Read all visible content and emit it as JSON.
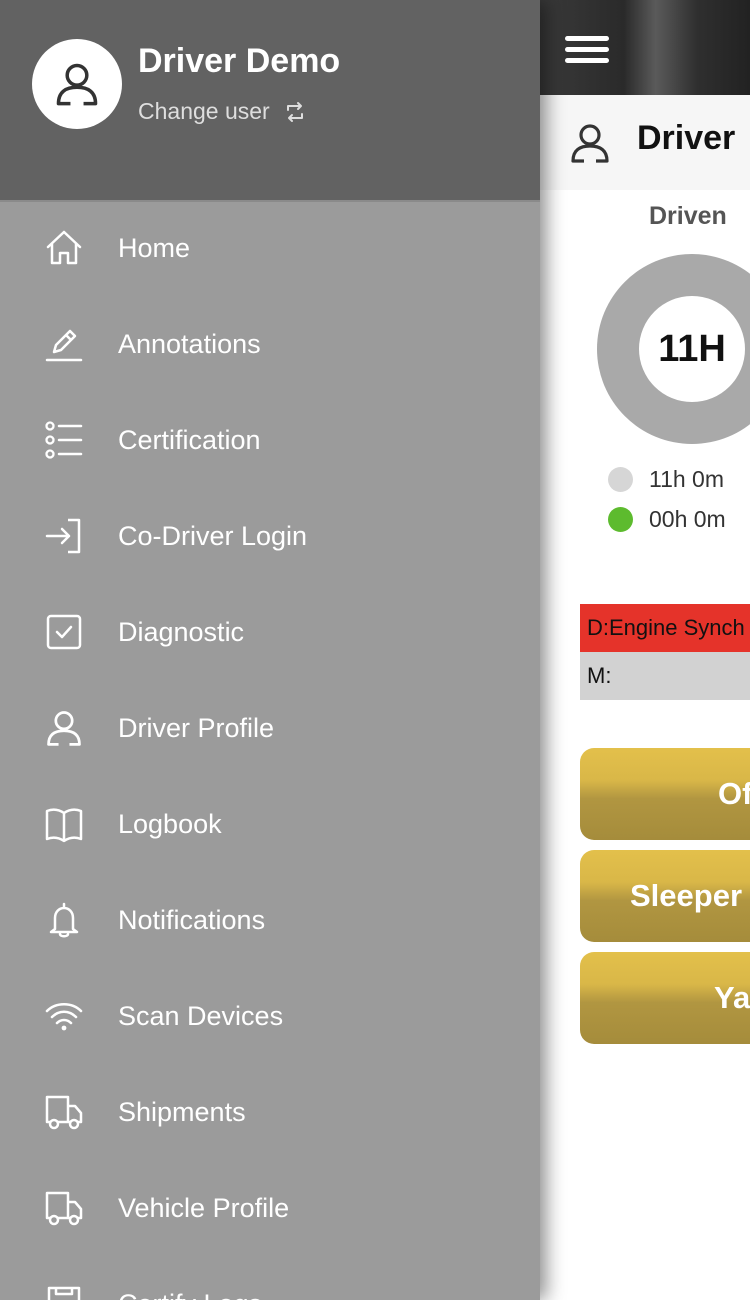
{
  "drawer": {
    "user": {
      "name": "Driver Demo",
      "change_user_label": "Change user"
    },
    "menu": [
      {
        "label": "Home",
        "icon": "home-icon"
      },
      {
        "label": "Annotations",
        "icon": "pencil-icon"
      },
      {
        "label": "Certification",
        "icon": "list-icon"
      },
      {
        "label": "Co-Driver Login",
        "icon": "login-icon"
      },
      {
        "label": "Diagnostic",
        "icon": "checkbox-icon"
      },
      {
        "label": "Driver Profile",
        "icon": "user-icon"
      },
      {
        "label": "Logbook",
        "icon": "book-icon"
      },
      {
        "label": "Notifications",
        "icon": "bell-icon"
      },
      {
        "label": "Scan Devices",
        "icon": "wifi-icon"
      },
      {
        "label": "Shipments",
        "icon": "truck-icon"
      },
      {
        "label": "Vehicle Profile",
        "icon": "truck-icon"
      },
      {
        "label": "Certify Logs",
        "icon": "document-icon"
      }
    ]
  },
  "main": {
    "driver_name": "Driver",
    "driven_label": "Driven",
    "donut_center_text": "11H",
    "legend": [
      {
        "text": "11h 0m",
        "color": "#d6d6d6"
      },
      {
        "text": "00h 0m",
        "color": "#5dbb2e"
      }
    ],
    "status_d": "D:Engine Synch",
    "status_m": "M:",
    "buttons": [
      "Off Duty",
      "Sleeper",
      "Yard"
    ]
  },
  "colors": {
    "drawer_bg": "#9b9b9b",
    "drawer_header_bg": "#626262",
    "status_red": "#e5332a",
    "button_gold": "#d4b448",
    "legend_green": "#5dbb2e"
  }
}
